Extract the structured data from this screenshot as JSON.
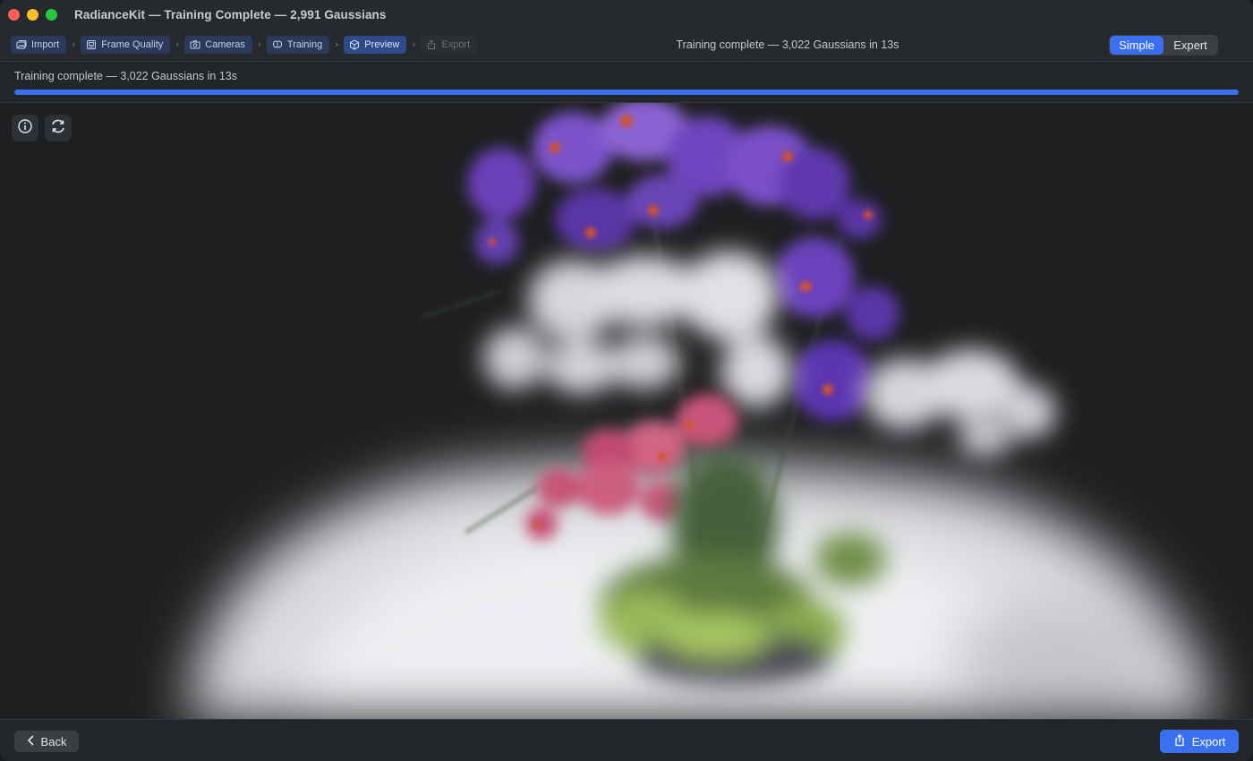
{
  "window": {
    "title": "RadianceKit — Training Complete — 2,991 Gaussians"
  },
  "toolbar": {
    "steps": [
      {
        "label": "Import",
        "icon": "photo-stack-icon",
        "state": "done"
      },
      {
        "label": "Frame Quality",
        "icon": "frame-icon",
        "state": "done"
      },
      {
        "label": "Cameras",
        "icon": "camera-icon",
        "state": "done"
      },
      {
        "label": "Training",
        "icon": "brain-icon",
        "state": "done"
      },
      {
        "label": "Preview",
        "icon": "cube-icon",
        "state": "active"
      },
      {
        "label": "Export",
        "icon": "share-icon",
        "state": "disabled"
      }
    ],
    "status": "Training complete — 3,022 Gaussians in 13s",
    "mode": {
      "options": [
        "Simple",
        "Expert"
      ],
      "selected": "Simple"
    }
  },
  "progress": {
    "text": "Training complete — 3,022 Gaussians in 13s",
    "fraction": 1.0
  },
  "viewport": {
    "buttons": [
      {
        "icon": "info-icon"
      },
      {
        "icon": "reset-view-icon"
      }
    ]
  },
  "footer": {
    "back_label": "Back",
    "export_label": "Export"
  },
  "colors": {
    "accent": "#3a6ff0",
    "background": "#232629"
  }
}
